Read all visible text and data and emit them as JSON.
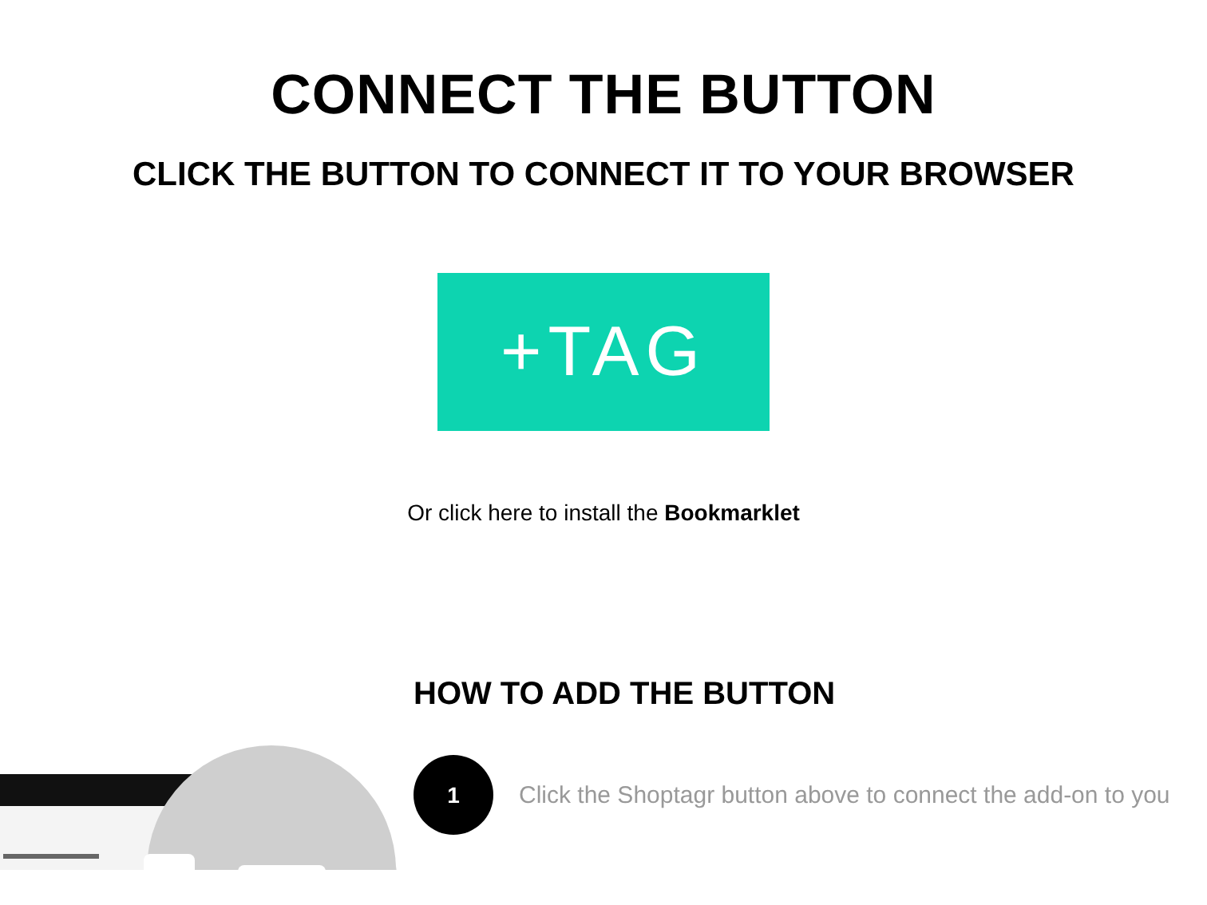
{
  "title": "CONNECT THE BUTTON",
  "subtitle": "CLICK THE BUTTON TO CONNECT IT TO YOUR BROWSER",
  "connect_button": {
    "label": "+TAG"
  },
  "bookmarklet_line": "Or click here to install the **Bookmarklet**",
  "how_to": {
    "heading": "HOW TO ADD THE BUTTON",
    "steps": [
      {
        "number": "1",
        "text": "Click the Shoptagr button above to connect the add-on to you"
      }
    ]
  }
}
